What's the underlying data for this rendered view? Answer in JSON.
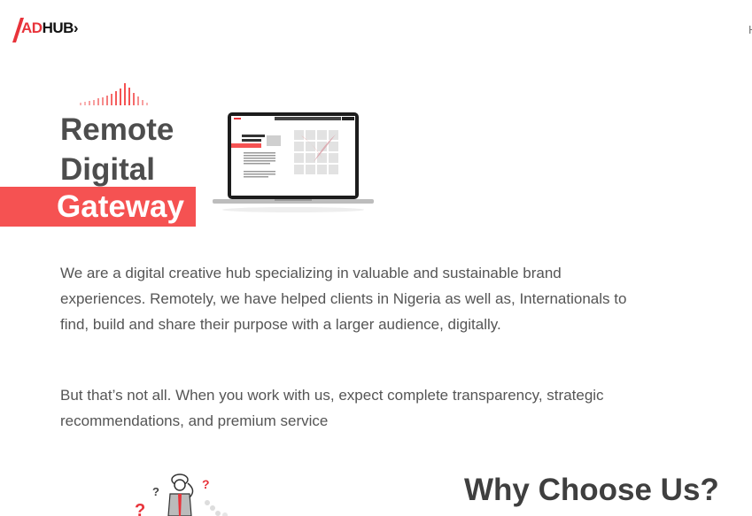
{
  "brand": {
    "logo_prefix": "AD",
    "logo_suffix": "HUB"
  },
  "nav": {
    "partial_item": "H"
  },
  "hero": {
    "title_line1": "Remote",
    "title_line2": "Digital",
    "title_highlight": "Gateway"
  },
  "about": {
    "paragraph1": "We are a digital creative hub specializing in valuable and sustainable brand experiences. Remotely, we have helped clients in Nigeria as well as, Internationals to find, build and share their purpose with a larger audience, digitally.",
    "paragraph2": "But that’s not all. When you work with us, expect complete transparency, strategic recommendations, and premium service"
  },
  "why": {
    "heading": "Why Choose Us?"
  },
  "colors": {
    "accent": "#f55252",
    "text": "#555555",
    "heading": "#4d4d4d"
  }
}
